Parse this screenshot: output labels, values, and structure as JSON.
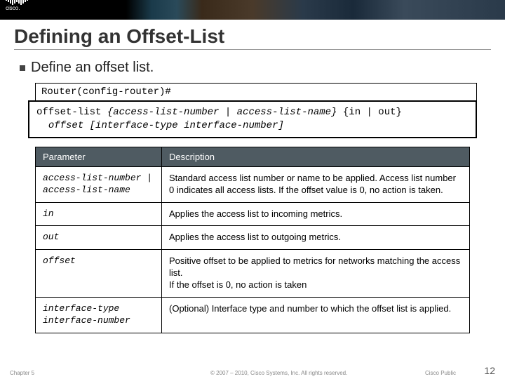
{
  "banner": {
    "logo_text": "cisco."
  },
  "title": "Defining an Offset-List",
  "bullet": "Define an offset list.",
  "prompt": "Router(config-router)#",
  "command": {
    "cmd": "offset-list",
    "arg1": "{access-list-number | access-list-name}",
    "arg2": "{in | out}",
    "arg3": "offset",
    "arg4": "[interface-type interface-number]"
  },
  "table": {
    "headers": {
      "param": "Parameter",
      "desc": "Description"
    },
    "rows": [
      {
        "param": "access-list-number | access-list-name",
        "desc": "Standard access list number or name to be applied. Access list number 0 indicates all access lists. If the offset value is 0, no action is taken."
      },
      {
        "param": "in",
        "desc": "Applies the access list to incoming metrics."
      },
      {
        "param": "out",
        "desc": "Applies the access list to outgoing metrics."
      },
      {
        "param": "offset",
        "desc": "Positive offset to be applied to metrics for networks matching the access list.\nIf the offset is 0, no action is taken"
      },
      {
        "param": "interface-type interface-number",
        "desc": "(Optional) Interface type and number to which the offset list is applied."
      }
    ]
  },
  "footer": {
    "chapter": "Chapter 5",
    "copyright": "© 2007 – 2010, Cisco Systems, Inc. All rights reserved.",
    "classification": "Cisco Public",
    "page": "12"
  }
}
